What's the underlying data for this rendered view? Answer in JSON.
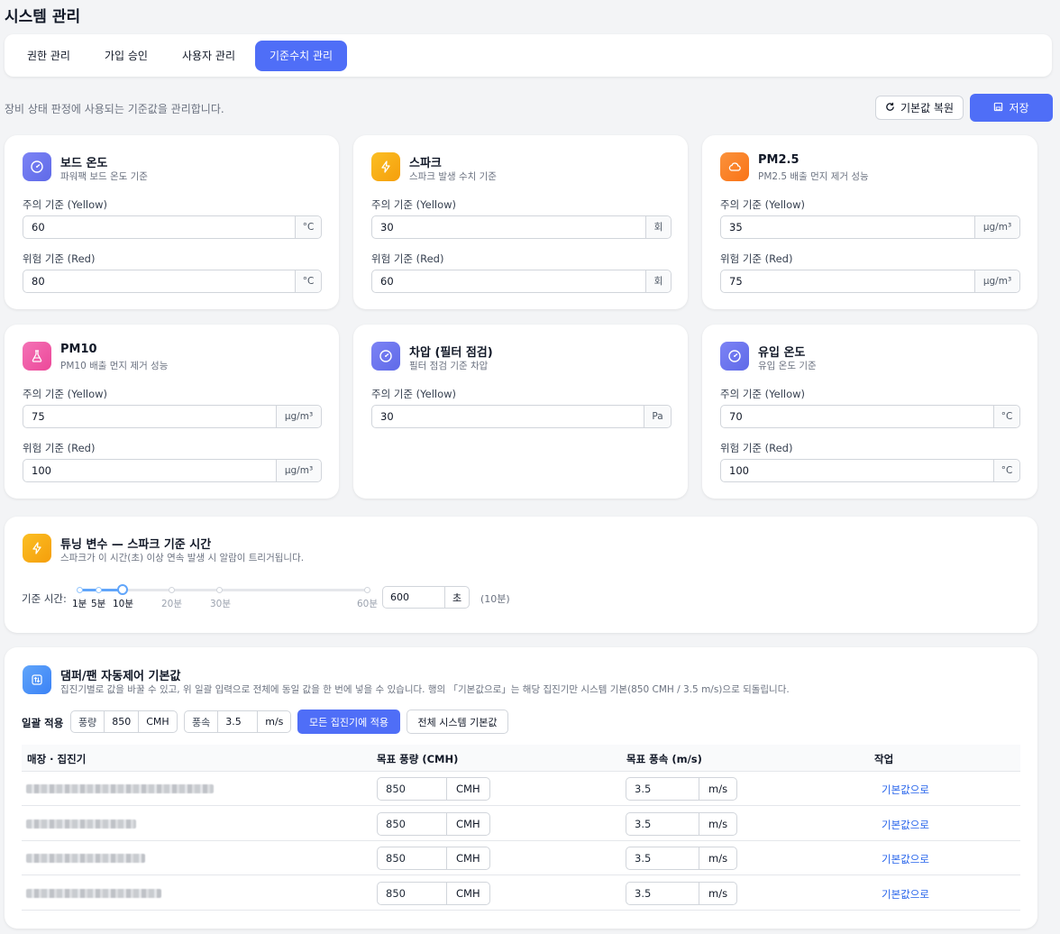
{
  "page_title": "시스템 관리",
  "tabs": [
    {
      "label": "권한 관리",
      "active": false
    },
    {
      "label": "가입 승인",
      "active": false
    },
    {
      "label": "사용자 관리",
      "active": false
    },
    {
      "label": "기준수치 관리",
      "active": true
    }
  ],
  "description": "장비 상태 판정에 사용되는 기준값을 관리합니다.",
  "actions": {
    "reset_label": "기본값 복원",
    "save_label": "저장"
  },
  "colors": {
    "accent": "#4f6ef7",
    "link": "#2563eb"
  },
  "cards": [
    {
      "title": "보드 온도",
      "subtitle": "파워팩 보드 온도 기준",
      "icon": "gauge-icon",
      "yellow_label": "주의 기준 (Yellow)",
      "yellow_value": "60",
      "red_label": "위험 기준 (Red)",
      "red_value": "80",
      "unit": "°C"
    },
    {
      "title": "스파크",
      "subtitle": "스파크 발생 수치 기준",
      "icon": "lightning-icon",
      "yellow_label": "주의 기준 (Yellow)",
      "yellow_value": "30",
      "red_label": "위험 기준 (Red)",
      "red_value": "60",
      "unit": "회"
    },
    {
      "title": "PM2.5",
      "subtitle": "PM2.5 배출 먼지 제거 성능",
      "icon": "cloud-icon",
      "yellow_label": "주의 기준 (Yellow)",
      "yellow_value": "35",
      "red_label": "위험 기준 (Red)",
      "red_value": "75",
      "unit": "μg/m³"
    },
    {
      "title": "PM10",
      "subtitle": "PM10 배출 먼지 제거 성능",
      "icon": "flask-icon",
      "yellow_label": "주의 기준 (Yellow)",
      "yellow_value": "75",
      "red_label": "위험 기준 (Red)",
      "red_value": "100",
      "unit": "μg/m³"
    },
    {
      "title": "차압 (필터 점검)",
      "subtitle": "필터 점검 기준 차압",
      "icon": "gauge-icon",
      "yellow_label": "주의 기준 (Yellow)",
      "yellow_value": "30",
      "unit": "Pa"
    },
    {
      "title": "유입 온도",
      "subtitle": "유입 온도 기준",
      "icon": "gauge-icon",
      "yellow_label": "주의 기준 (Yellow)",
      "yellow_value": "70",
      "red_label": "위험 기준 (Red)",
      "red_value": "100",
      "unit": "°C"
    }
  ],
  "tuning": {
    "title": "튜닝 변수 — 스파크 기준 시간",
    "subtitle": "스파크가 이 시간(초) 이상 연속 발생 시 알람이 트리거됩니다.",
    "label": "기준 시간:",
    "ticks": [
      "1분",
      "5분",
      "10분",
      "20분",
      "30분",
      "60분"
    ],
    "selected": "10분",
    "value": "600",
    "unit": "초",
    "hint": "(10분)"
  },
  "damper": {
    "title": "댐퍼/팬 자동제어 기본값",
    "subtitle": "집진기별로 값을 바꿀 수 있고, 위 일괄 입력으로 전체에 동일 값을 한 번에 넣을 수 있습니다. 행의 「기본값으로」는 해당 집진기만 시스템 기본(850 CMH / 3.5 m/s)으로 되돌립니다.",
    "bulk_label": "일괄 적용",
    "flow_label": "풍량",
    "flow_value": "850",
    "flow_unit": "CMH",
    "speed_label": "풍속",
    "speed_value": "3.5",
    "speed_unit": "m/s",
    "apply_all_label": "모든 집진기에 적용",
    "system_default_label": "전체 시스템 기본값",
    "columns": [
      "매장 · 집진기",
      "목표 풍량 (CMH)",
      "목표 풍속 (m/s)",
      "작업"
    ],
    "rows": [
      {
        "flow": "850",
        "flow_unit": "CMH",
        "speed": "3.5",
        "speed_unit": "m/s",
        "action": "기본값으로"
      },
      {
        "flow": "850",
        "flow_unit": "CMH",
        "speed": "3.5",
        "speed_unit": "m/s",
        "action": "기본값으로"
      },
      {
        "flow": "850",
        "flow_unit": "CMH",
        "speed": "3.5",
        "speed_unit": "m/s",
        "action": "기본값으로"
      },
      {
        "flow": "850",
        "flow_unit": "CMH",
        "speed": "3.5",
        "speed_unit": "m/s",
        "action": "기본값으로"
      }
    ]
  }
}
